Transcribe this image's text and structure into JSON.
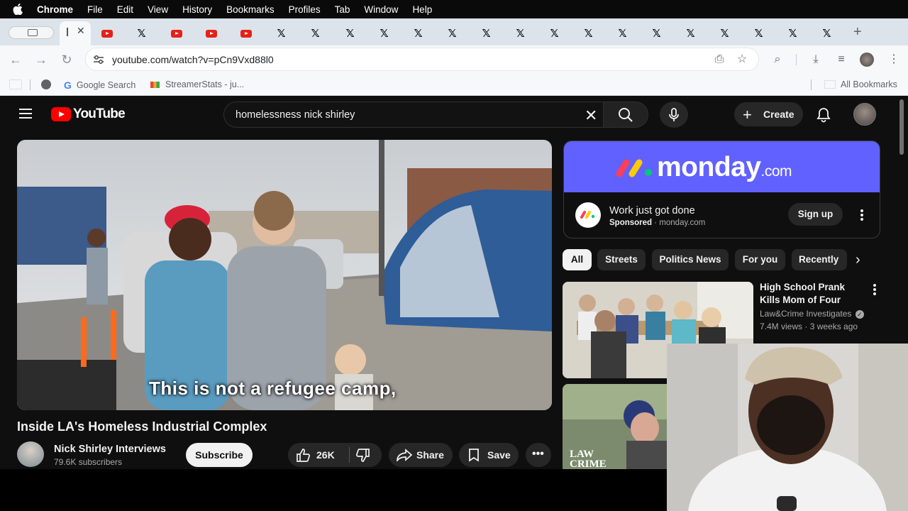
{
  "menubar": {
    "items": [
      "Chrome",
      "File",
      "Edit",
      "View",
      "History",
      "Bookmarks",
      "Profiles",
      "Tab",
      "Window",
      "Help"
    ]
  },
  "browser": {
    "url": "youtube.com/watch?v=pCn9Vxd88l0",
    "bookmarks": [
      "Google Search",
      "StreamerStats - ju...",
      "All Bookmarks"
    ]
  },
  "youtube": {
    "logo_text": "YouTube",
    "search_query": "homelessness nick shirley",
    "create_label": "Create",
    "video": {
      "subtitle": "This is not a refugee camp,",
      "title": "Inside LA's Homeless Industrial Complex",
      "channel": "Nick Shirley Interviews",
      "subscribers": "79.6K subscribers",
      "subscribe_label": "Subscribe",
      "likes": "26K",
      "share_label": "Share",
      "save_label": "Save"
    },
    "ad": {
      "brand": "monday",
      "brand_suffix": ".com",
      "headline": "Work just got done",
      "sponsored_label": "Sponsored",
      "sponsor_domain": "monday.com",
      "cta": "Sign up"
    },
    "chips": [
      "All",
      "Streets",
      "Politics News",
      "For you",
      "Recently u"
    ],
    "related": [
      {
        "title": "High School Prank Kills Mom of Four",
        "channel": "Law&Crime Investigates",
        "views": "7.4M views",
        "age": "3 weeks ago"
      },
      {
        "thumb_text_1": "LAW",
        "thumb_text_2": "CRIME"
      }
    ]
  },
  "colors": {
    "yt_bg": "#0f0f0f",
    "yt_red": "#ff0000",
    "monday_purple": "#6161ff",
    "chrome_tabstrip": "#dde3ea"
  }
}
